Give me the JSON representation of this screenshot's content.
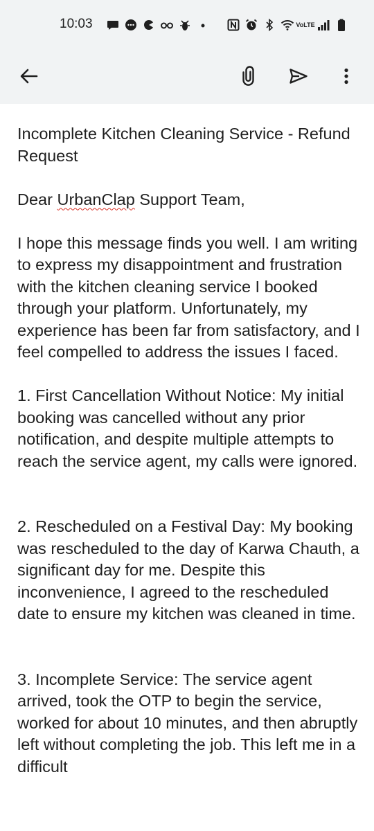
{
  "status_bar": {
    "time": "10:03",
    "notification_icons": [
      "chat-bubble-icon",
      "message-dots-icon",
      "pacman-icon",
      "glasses-icon",
      "bug-icon",
      "dot-icon"
    ],
    "system_icons": [
      "nfc-icon",
      "alarm-icon",
      "bluetooth-icon",
      "wifi-icon",
      "volte-icon",
      "signal-icon",
      "battery-icon"
    ],
    "volte_line1": "Vo",
    "volte_line2": "LTE"
  },
  "app_bar": {
    "icons": [
      "back-arrow-icon",
      "paperclip-icon",
      "send-icon",
      "more-vert-icon"
    ]
  },
  "email": {
    "subject": "Incomplete Kitchen Cleaning Service - Refund Request",
    "greeting_before": "Dear ",
    "greeting_misspelled": "UrbanClap",
    "greeting_after": " Support Team,",
    "paragraph_intro": "I hope this message finds you well. I am writing to express my disappointment and frustration with the kitchen cleaning service I booked through your platform. Unfortunately, my experience has been far from satisfactory, and I feel compelled to address the issues I faced.",
    "point_1": "1. First Cancellation Without Notice: My initial booking was cancelled without any prior notification, and despite multiple attempts to reach the service agent, my calls were ignored.",
    "point_2": "2. Rescheduled on a Festival Day: My booking was rescheduled to the day of Karwa Chauth, a significant day for me. Despite this inconvenience, I agreed to the rescheduled date to ensure my kitchen was cleaned in time.",
    "point_3": "3. Incomplete Service: The service agent arrived, took the OTP to begin the service, worked for about 10 minutes, and then abruptly left without completing the job. This left me in a difficult"
  },
  "colors": {
    "bar_background": "#f1f3f4",
    "text": "#1f1f1f",
    "spellcheck": "#d93025"
  }
}
